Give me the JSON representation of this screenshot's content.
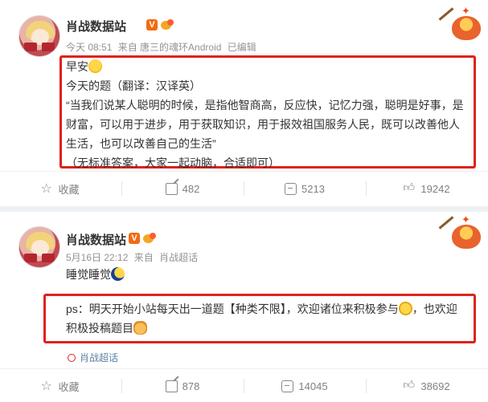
{
  "posts": [
    {
      "author": "肖战数据站",
      "verified_badge": "V",
      "meta": {
        "time": "今天 08:51",
        "source": "来自 唐三的魂环Android",
        "edited": "已编辑"
      },
      "lines": [
        "早安",
        "今天的题（翻译：汉译英）",
        "“当我们说某人聪明的时候，是指他智商高，反应快，记忆力强，聪明是好事，是",
        "财富，可以用于进步，用于获取知识，用于报效祖国服务人民，既可以改善他人",
        "生活，也可以改善自己的生活”",
        "（无标准答案，大家一起动脑，合适即可）"
      ],
      "actions": {
        "favorite": "收藏",
        "repost": "482",
        "comment": "5213",
        "like": "19242"
      }
    },
    {
      "author": "肖战数据站",
      "verified_badge": "V",
      "meta": {
        "time": "5月16日 22:12",
        "source": "来自",
        "topic_source": "肖战超话"
      },
      "line1": "睡觉睡觉",
      "ps_line1": "ps：明天开始小站每天出一道题【种类不限】，欢迎诸位来积极参与",
      "ps_line1_end": "，也欢迎",
      "ps_line2": "积极投稿题目",
      "topic_tag": "肖战超话",
      "actions": {
        "favorite": "收藏",
        "repost": "878",
        "comment": "14045",
        "like": "38692"
      }
    }
  ],
  "colors": {
    "highlight_box": "#e0211b",
    "verified": "#f26a12",
    "meta": "#939393",
    "topic": "#5d7fa3"
  },
  "icons": [
    "star-icon",
    "repost-icon",
    "comment-icon",
    "like-icon",
    "verified-icon",
    "crown-badge-icon",
    "hotpot-decoration",
    "topic-icon"
  ]
}
